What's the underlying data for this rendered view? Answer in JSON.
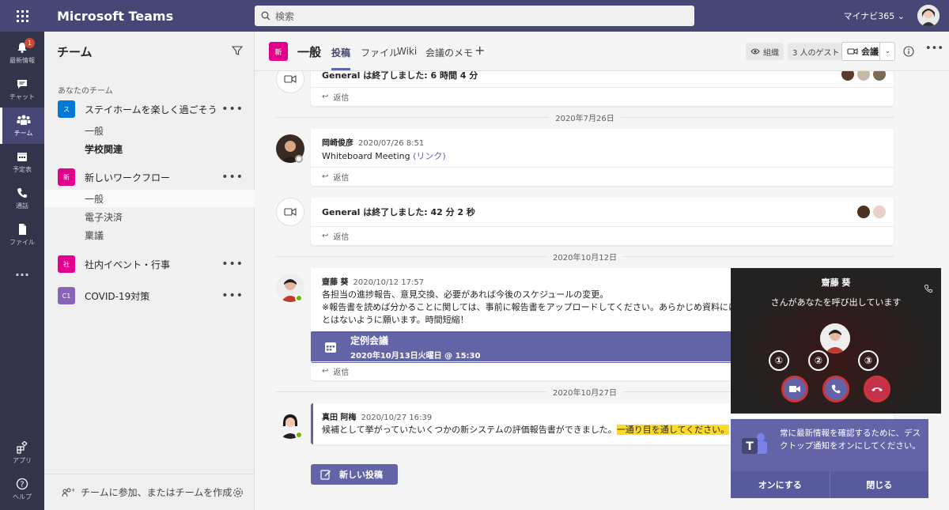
{
  "app": {
    "title": "Microsoft Teams",
    "org": "マイナビ365 ⌄"
  },
  "search": {
    "placeholder": "検索"
  },
  "rail": {
    "items": [
      {
        "label": "最新情報",
        "badge": "1"
      },
      {
        "label": "チャット"
      },
      {
        "label": "チーム"
      },
      {
        "label": "予定表"
      },
      {
        "label": "通話"
      },
      {
        "label": "ファイル"
      },
      {
        "label": "..."
      },
      {
        "label": "アプリ"
      },
      {
        "label": "ヘルプ"
      }
    ]
  },
  "teams_panel": {
    "title": "チーム",
    "section": "あなたのチーム",
    "teams": [
      {
        "tile": "ス",
        "name": "ステイホームを楽しく過ごそう",
        "color": "#0078d4",
        "channels": [
          "一般",
          "学校関連"
        ]
      },
      {
        "tile": "新",
        "name": "新しいワークフロー",
        "color": "#e3008c",
        "channels": [
          "一般",
          "電子決済",
          "稟議"
        ]
      },
      {
        "tile": "社",
        "name": "社内イベント・行事",
        "color": "#e3008c",
        "channels": []
      },
      {
        "tile": "C1",
        "name": "COVID-19対策",
        "color": "#8764b8",
        "channels": []
      }
    ],
    "footer": "チームに参加、またはチームを作成"
  },
  "channel_header": {
    "tile": "新",
    "name": "一般",
    "tabs": [
      "投稿",
      "ファイル",
      "Wiki",
      "会議のメモ",
      "+"
    ],
    "org_button": "組織",
    "guests_button": "3 人のゲスト",
    "meet_button": "会議"
  },
  "feed": {
    "reply_label": "返信",
    "posts": [
      {
        "text": "General は終了しました: 6 時間 4 分"
      },
      {
        "date": "2020年7月26日"
      },
      {
        "author": "岡崎俊彦",
        "time": "2020/07/26 8:51",
        "text": "Whiteboard Meeting",
        "link": "(リンク)"
      },
      {
        "text": "General は終了しました: 42 分 2 秒"
      },
      {
        "date": "2020年10月12日"
      },
      {
        "author": "齋藤 葵",
        "time": "2020/10/12 17:57",
        "lines": [
          "各担当の進捗報告、意見交換、必要があれば今後のスケジュールの変更。",
          "※報告書を読めば分かることに関しては、事前に報告書をアップロードしてください。あらかじめ資料には目を通してお",
          "とはないように願います。時間短縮！"
        ],
        "meeting": {
          "title": "定例会議",
          "when": "2020年10月13日火曜日 @ 15:30"
        }
      },
      {
        "date": "2020年10月27日"
      },
      {
        "author": "真田 阿梅",
        "time": "2020/10/27 16:39",
        "text": "候補として挙がっていたいくつかの新システムの評価報告書ができました。",
        "highlight": "一通り目を通してください。"
      }
    ],
    "new_post": "新しい投稿"
  },
  "call": {
    "caller": "齋藤 葵",
    "subtitle": "さんがあなたを呼び出しています",
    "labels": [
      "①",
      "②",
      "③"
    ]
  },
  "notification": {
    "text": "常に最新情報を確認するために、デスクトップ通知をオンにしてください。",
    "turn_on": "オンにする",
    "close": "閉じる"
  }
}
